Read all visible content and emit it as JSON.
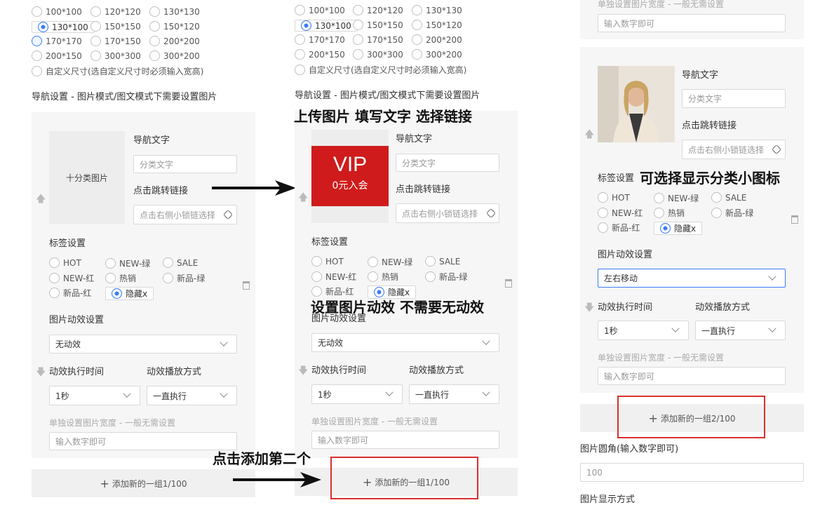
{
  "sizes": {
    "options": [
      "100*100",
      "120*120",
      "130*130",
      "130*100",
      "150*150",
      "150*120",
      "170*170",
      "170*150",
      "200*200",
      "200*150",
      "300*300",
      "300*200"
    ],
    "custom": "自定义尺寸(选自定义尺寸时必须输入宽高)"
  },
  "nav_section_title": "导航设置 - 图片模式/图文模式下需要设置图片",
  "item": {
    "nav_text_label": "导航文字",
    "nav_text_placeholder": "分类文字",
    "jump_link_label": "点击跳转链接",
    "jump_link_placeholder": "点击右侧小锁链选择",
    "upload_label": "十分类图片",
    "tag_label": "标签设置",
    "tags": [
      "HOT",
      "NEW-绿",
      "SALE",
      "NEW-红",
      "热销",
      "新品-绿",
      "新品-红",
      "隐藏x"
    ],
    "anim_label": "图片动效设置",
    "anim_value_none": "无动效",
    "anim_value_lr": "左右移动",
    "exec_time_label": "动效执行时间",
    "play_mode_label": "动效播放方式",
    "exec_time_value": "1秒",
    "play_mode_value": "一直执行",
    "width_label": "单独设置图片宽度 - 一般无需设置",
    "width_placeholder": "输入数字即可"
  },
  "vip": {
    "title": "VIP",
    "sub": "0元入会"
  },
  "add_btn_1": "添加新的一组1/100",
  "add_btn_2": "添加新的一组2/100",
  "corner_label": "图片圆角(输入数字即可)",
  "corner_value": "100",
  "display_mode_label": "图片显示方式",
  "annotations": {
    "upload": "上传图片 填写文字 选择链接",
    "anim": "设置图片动效 不需要无动效",
    "add_second": "点击添加第二个",
    "tag_icon": "可选择显示分类小图标"
  }
}
